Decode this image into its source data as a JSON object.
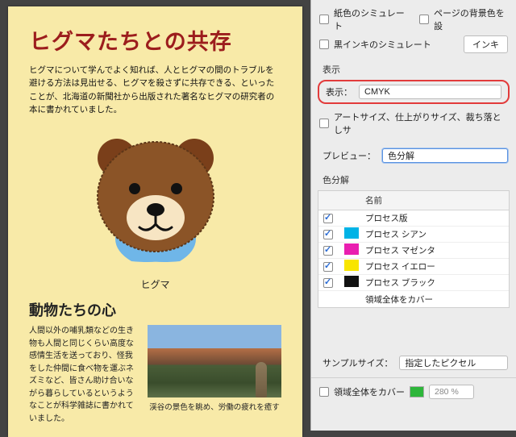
{
  "doc": {
    "title": "ヒグマたちとの共存",
    "lead": "ヒグマについて学んでよく知れば、人とヒグマの間のトラブルを避ける方法は見出せる、ヒグマを殺さずに共存できる、といったことが、北海道の新聞社から出版された著名なヒグマの研究者の本に書かれていました。",
    "bear_caption": "ヒグマ",
    "sub_title": "動物たちの心",
    "lower_text": "人間以外の哺乳類などの生き物も人間と同じくらい高度な感情生活を送っており、怪我をした仲間に食べ物を運ぶネズミなど、皆さん助け合いながら暮らしているというようなことが科学雑誌に書かれていました。",
    "photo_caption": "渓谷の景色を眺め、労働の疲れを癒す"
  },
  "panel": {
    "simulate_paper": "紙色のシミュレート",
    "simulate_bg": "ページの背景色を設",
    "simulate_black": "黒インキのシミュレート",
    "ink_button": "インキ",
    "section_display": "表示",
    "display_label": "表示：",
    "display_value": "CMYK",
    "artsize": "アートサイズ、仕上がりサイズ、裁ち落としサ",
    "preview_label": "プレビュー：",
    "preview_value": "色分解",
    "section_sep": "色分解",
    "col_name": "名前",
    "plates": [
      {
        "checked": true,
        "swatch": null,
        "name": "プロセス版"
      },
      {
        "checked": true,
        "swatch": "#00B3E6",
        "name": "プロセス シアン"
      },
      {
        "checked": true,
        "swatch": "#E91FB0",
        "name": "プロセス マゼンタ"
      },
      {
        "checked": true,
        "swatch": "#F8E500",
        "name": "プロセス イエロー"
      },
      {
        "checked": true,
        "swatch": "#111111",
        "name": "プロセス ブラック"
      },
      {
        "checked": false,
        "swatch": null,
        "name": "領域全体をカバー"
      }
    ],
    "sample_size_label": "サンプルサイズ：",
    "sample_size_value": "指定したピクセル",
    "cover_all": "領域全体をカバー",
    "cover_value": "280"
  }
}
